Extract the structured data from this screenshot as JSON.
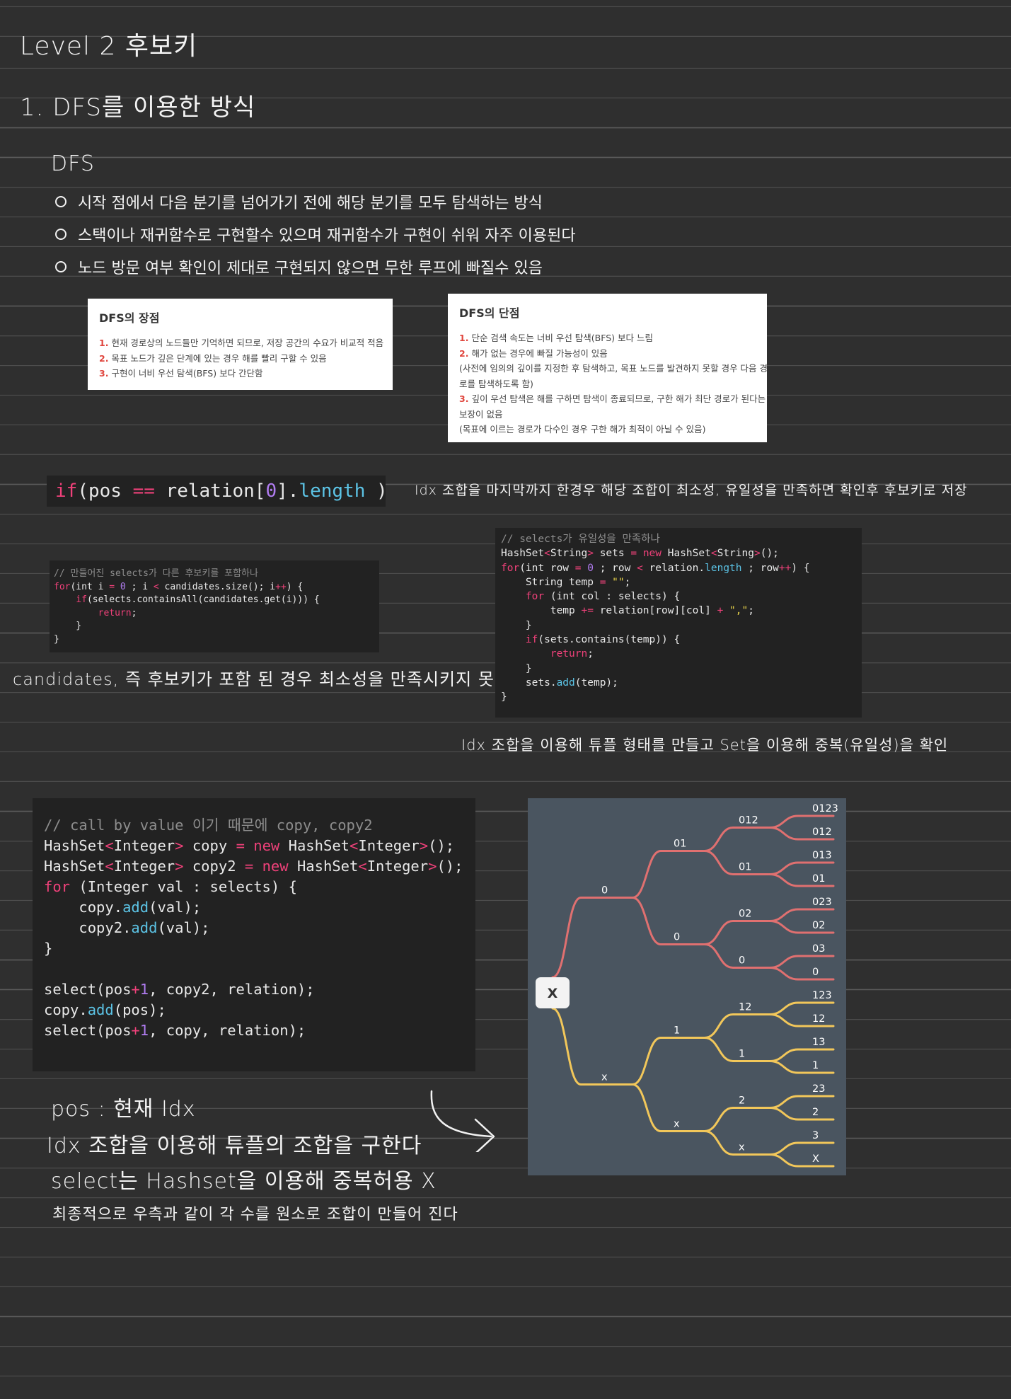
{
  "title": "Level 2 후보키",
  "section": "1. DFS를 이용한 방식",
  "dfs_heading": "DFS",
  "bullets": [
    "시작 점에서 다음 분기를 넘어가기 전에 해당 분기를 모두 탐색하는 방식",
    "스택이나 재귀함수로 구현할수 있으며 재귀함수가 구현이 쉬워 자주 이용된다",
    "노드 방문 여부 확인이 제대로 구현되지 않으면 무한 루프에 빠질수 있음"
  ],
  "pros_card": {
    "title": "DFS의 장점",
    "items": [
      {
        "num": "1.",
        "text": "현재 경로상의 노드들만 기억하면 되므로, 저장 공간의 수요가 비교적 적음"
      },
      {
        "num": "2.",
        "text": "목표 노드가 깊은 단계에 있는 경우 해를 빨리 구할 수 있음"
      },
      {
        "num": "3.",
        "text": "구현이 너비 우선 탐색(BFS) 보다 간단함"
      }
    ]
  },
  "cons_card": {
    "title": "DFS의 단점",
    "lines": [
      {
        "num": "1.",
        "text": "단순 검색 속도는 너비 우선 탐색(BFS) 보다 느림"
      },
      {
        "num": "2.",
        "text": "해가 없는 경우에 빠질 가능성이 있음"
      },
      {
        "num": "",
        "text": "(사전에 임의의 깊이를 지정한 후 탐색하고, 목표 노드를 발견하지 못할 경우 다음 경"
      },
      {
        "num": "",
        "text": "로를 탐색하도록 함)"
      },
      {
        "num": "3.",
        "text": "깊이 우선 탐색은 해를 구하면 탐색이 종료되므로, 구한 해가 최단 경로가 된다는"
      },
      {
        "num": "",
        "text": "보장이 없음"
      },
      {
        "num": "",
        "text": "(목표에 이르는 경로가 다수인 경우 구한 해가 최적이 아닐 수 있음)"
      }
    ]
  },
  "code_if": [
    [
      [
        "kw",
        "if"
      ],
      [
        "",
        "(pos "
      ],
      [
        "kw",
        "=="
      ],
      [
        "",
        " relation["
      ],
      [
        "num",
        "0"
      ],
      [
        "",
        "]."
      ],
      [
        "fn",
        "length"
      ],
      [
        "",
        " )"
      ]
    ]
  ],
  "note_if": "Idx 조합을 마지막까지 한경우 해당 조합이 최소성, 유일성을 만족하면 확인후 후보키로 저장",
  "code_candidates": [
    [
      [
        "cmt",
        "// 만들어진 selects가 다른 후보키를 포함하나"
      ]
    ],
    [
      [
        "kw",
        "for"
      ],
      [
        "",
        "(int i "
      ],
      [
        "kw",
        "="
      ],
      [
        "num",
        " 0"
      ],
      [
        "",
        " ; i "
      ],
      [
        "kw",
        "<"
      ],
      [
        "",
        " candidates.size(); i"
      ],
      [
        "kw",
        "++"
      ],
      [
        "",
        ") {"
      ]
    ],
    [
      [
        "",
        "    "
      ],
      [
        "kw",
        "if"
      ],
      [
        "",
        "(selects.containsAll(candidates.get(i))) {"
      ]
    ],
    [
      [
        "",
        "        "
      ],
      [
        "kw",
        "return"
      ],
      [
        "",
        ";"
      ]
    ],
    [
      [
        "",
        "    }"
      ]
    ],
    [
      [
        "",
        "}"
      ]
    ]
  ],
  "note_candidates": "candidates, 즉 후보키가 포함 된 경우 최소성을 만족시키지 못함",
  "code_unique": [
    [
      [
        "cmt",
        "// selects가 유일성을 만족하나"
      ]
    ],
    [
      [
        "",
        "HashSet"
      ],
      [
        "kw",
        "<"
      ],
      [
        "",
        "String"
      ],
      [
        "kw",
        ">"
      ],
      [
        "",
        " sets "
      ],
      [
        "kw",
        "="
      ],
      [
        "kw",
        " new"
      ],
      [
        "",
        " HashSet"
      ],
      [
        "kw",
        "<"
      ],
      [
        "",
        "String"
      ],
      [
        "kw",
        ">"
      ],
      [
        "",
        "();"
      ]
    ],
    [
      [
        "kw",
        "for"
      ],
      [
        "",
        "(int row "
      ],
      [
        "kw",
        "="
      ],
      [
        "num",
        " 0"
      ],
      [
        "",
        " ; row "
      ],
      [
        "kw",
        "<"
      ],
      [
        "",
        " relation."
      ],
      [
        "fn",
        "length"
      ],
      [
        "",
        " ; row"
      ],
      [
        "kw",
        "++"
      ],
      [
        "",
        ") {"
      ]
    ],
    [
      [
        "",
        "    String temp "
      ],
      [
        "kw",
        "="
      ],
      [
        "str",
        " \"\""
      ],
      [
        "",
        ";"
      ]
    ],
    [
      [
        "",
        "    "
      ],
      [
        "kw",
        "for"
      ],
      [
        "",
        " (int col : selects) {"
      ]
    ],
    [
      [
        "",
        "        temp "
      ],
      [
        "kw",
        "+="
      ],
      [
        "",
        " relation[row][col] "
      ],
      [
        "kw",
        "+"
      ],
      [
        "str",
        " \",\""
      ],
      [
        "",
        ";"
      ]
    ],
    [
      [
        "",
        "    }"
      ]
    ],
    [
      [
        "",
        "    "
      ],
      [
        "kw",
        "if"
      ],
      [
        "",
        "(sets.contains(temp)) {"
      ]
    ],
    [
      [
        "",
        "        "
      ],
      [
        "kw",
        "return"
      ],
      [
        "",
        ";"
      ]
    ],
    [
      [
        "",
        "    }"
      ]
    ],
    [
      [
        "",
        "    sets."
      ],
      [
        "fn",
        "add"
      ],
      [
        "",
        "(temp);"
      ]
    ],
    [
      [
        "",
        "}"
      ]
    ]
  ],
  "note_unique": "Idx 조합을 이용해 튜플 형태를 만들고 Set을 이용해 중복(유일성)을 확인",
  "code_copy": [
    [
      [
        "cmt",
        "// call by value 이기 때문에 copy, copy2"
      ]
    ],
    [
      [
        "",
        "HashSet"
      ],
      [
        "kw",
        "<"
      ],
      [
        "",
        "Integer"
      ],
      [
        "kw",
        ">"
      ],
      [
        "",
        " copy "
      ],
      [
        "kw",
        "="
      ],
      [
        "kw",
        " new"
      ],
      [
        "",
        " HashSet"
      ],
      [
        "kw",
        "<"
      ],
      [
        "",
        "Integer"
      ],
      [
        "kw",
        ">"
      ],
      [
        "",
        "();"
      ]
    ],
    [
      [
        "",
        "HashSet"
      ],
      [
        "kw",
        "<"
      ],
      [
        "",
        "Integer"
      ],
      [
        "kw",
        ">"
      ],
      [
        "",
        " copy2 "
      ],
      [
        "kw",
        "="
      ],
      [
        "kw",
        " new"
      ],
      [
        "",
        " HashSet"
      ],
      [
        "kw",
        "<"
      ],
      [
        "",
        "Integer"
      ],
      [
        "kw",
        ">"
      ],
      [
        "",
        "();"
      ]
    ],
    [
      [
        "kw",
        "for"
      ],
      [
        "",
        " (Integer val : selects) {"
      ]
    ],
    [
      [
        "",
        "    copy."
      ],
      [
        "fn",
        "add"
      ],
      [
        "",
        "(val);"
      ]
    ],
    [
      [
        "",
        "    copy2."
      ],
      [
        "fn",
        "add"
      ],
      [
        "",
        "(val);"
      ]
    ],
    [
      [
        "",
        "}"
      ]
    ],
    [
      [
        "",
        ""
      ]
    ],
    [
      [
        "",
        "select(pos"
      ],
      [
        "kw",
        "+"
      ],
      [
        "num",
        "1"
      ],
      [
        "",
        ", copy2, relation);"
      ]
    ],
    [
      [
        "",
        "copy."
      ],
      [
        "fn",
        "add"
      ],
      [
        "",
        "(pos);"
      ]
    ],
    [
      [
        "",
        "select(pos"
      ],
      [
        "kw",
        "+"
      ],
      [
        "num",
        "1"
      ],
      [
        "",
        ", copy, relation);"
      ]
    ]
  ],
  "notes_bottom": [
    "pos : 현재 Idx",
    "Idx 조합을 이용해 튜플의 조합을 구한다",
    "select는 Hashset을 이용해 중복허용 X",
    "최종적으로 우측과 같이 각 수를 원소로 조합이 만들어 진다"
  ],
  "tree": {
    "root": "X",
    "colors": {
      "bg": "#4a5560",
      "upper": "#e07070",
      "lower": "#f2c75a",
      "text": "#ffffff"
    },
    "level1": [
      "0",
      "x"
    ],
    "level2": [
      "01",
      "0",
      "1",
      "x"
    ],
    "level3": [
      "012",
      "01",
      "02",
      "0",
      "12",
      "1",
      "2",
      "x"
    ],
    "leaves": [
      "0123",
      "012",
      "013",
      "01",
      "023",
      "02",
      "03",
      "0",
      "123",
      "12",
      "13",
      "1",
      "23",
      "2",
      "3",
      "X"
    ]
  }
}
